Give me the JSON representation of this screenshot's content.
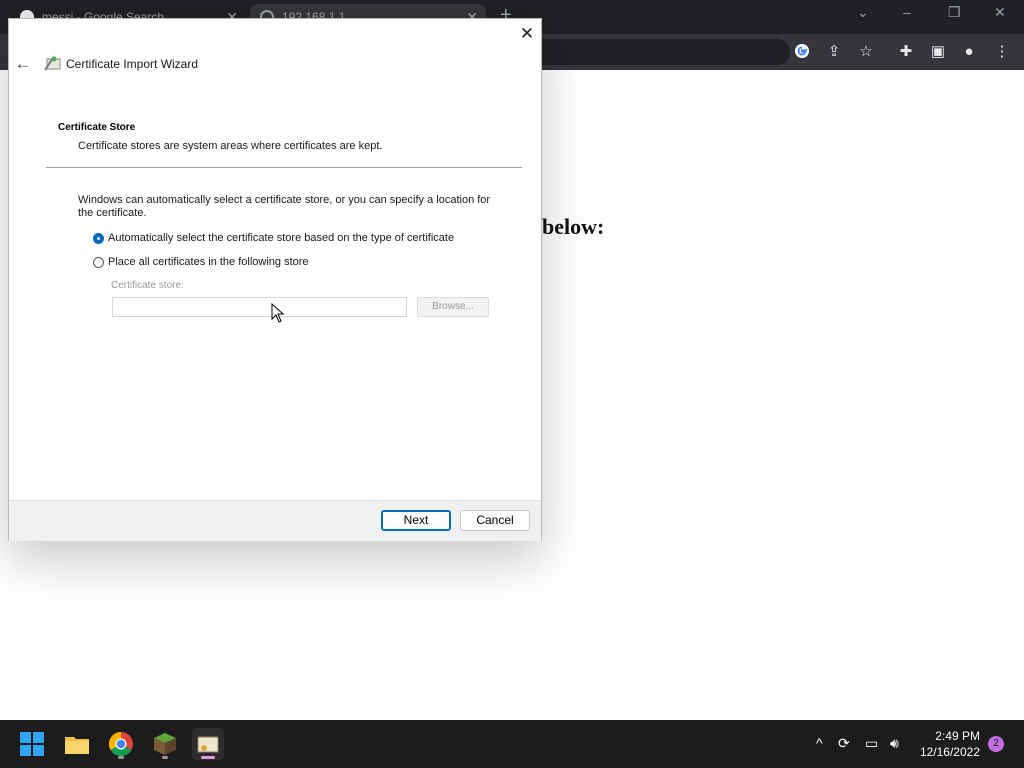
{
  "browser": {
    "tabs": [
      {
        "title": "messi - Google Search",
        "close": "✕"
      },
      {
        "title": "192.168.1.1",
        "close": "✕"
      }
    ],
    "new_tab": "+",
    "window_controls": {
      "minimize": "–",
      "restore": "❐",
      "close": "✕",
      "tab_search": "⌄"
    }
  },
  "page": {
    "heading_fragment": "below:"
  },
  "dialog": {
    "close_glyph": "✕",
    "back_glyph": "←",
    "title": "Certificate Import Wizard",
    "section_title": "Certificate Store",
    "section_desc": "Certificate stores are system areas where certificates are kept.",
    "intro": "Windows can automatically select a certificate store, or you can specify a location for the certificate.",
    "options": [
      {
        "label": "Automatically select the certificate store based on the type of certificate",
        "selected": true
      },
      {
        "label": "Place all certificates in the following store",
        "selected": false
      }
    ],
    "store_label": "Certificate store:",
    "store_value": "",
    "browse_label": "Browse...",
    "next_label": "Next",
    "cancel_label": "Cancel"
  },
  "taskbar": {
    "time": "2:49 PM",
    "date": "12/16/2022",
    "notification_count": "2",
    "tray_up": "^"
  },
  "colors": {
    "accent": "#0067c0",
    "taskbar": "#1c1c1c",
    "chrome_dark": "#202124"
  }
}
